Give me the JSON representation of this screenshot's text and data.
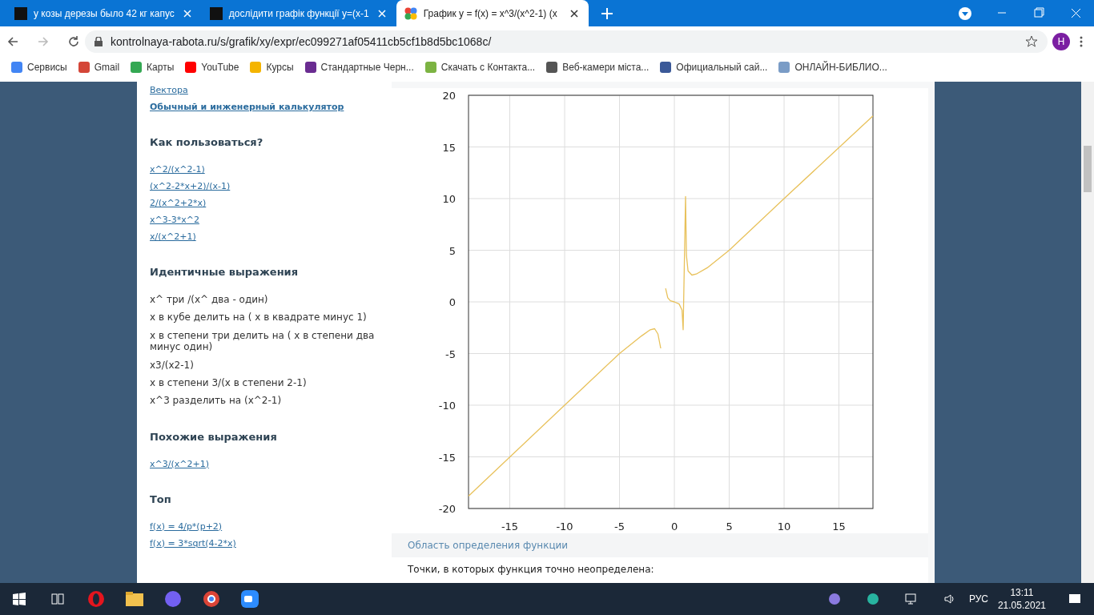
{
  "browser": {
    "tabs": [
      {
        "title": "у козы дерезы было 42 кг капус",
        "selected": false
      },
      {
        "title": "дослідити графік функції y=(x-1",
        "selected": false
      },
      {
        "title": "График y = f(x) = x^3/(x^2-1) (x",
        "selected": true
      }
    ],
    "url": "kontrolnaya-rabota.ru/s/grafik/xy/expr/ec099271af05411cb5cf1b8d5bc1068c/",
    "profile": "Н",
    "bookmarks": [
      {
        "label": "Сервисы",
        "color": "#4285f4"
      },
      {
        "label": "Gmail",
        "color": "#d44638"
      },
      {
        "label": "Карты",
        "color": "#34a853"
      },
      {
        "label": "YouTube",
        "color": "#ff0000"
      },
      {
        "label": "Курсы",
        "color": "#f4b400"
      },
      {
        "label": "Стандартные Черн...",
        "color": "#6a2c91"
      },
      {
        "label": "Скачать с Контакта...",
        "color": "#7cb342"
      },
      {
        "label": "Веб-камери міста...",
        "color": "#555555"
      },
      {
        "label": "Официальный сай...",
        "color": "#3b5998"
      },
      {
        "label": "ОНЛАЙН-БИБЛИО...",
        "color": "#7a9cc6"
      }
    ]
  },
  "sidebar": {
    "top_links": [
      {
        "text": "Вектора",
        "bold": false
      },
      {
        "text": "Обычный и инженерный калькулятор",
        "bold": true
      }
    ],
    "sections": [
      {
        "heading": "Как пользоваться?",
        "kind": "links",
        "items": [
          "x^2/(x^2-1)",
          "(x^2-2*x+2)/(x-1)",
          "2/(x^2+2*x)",
          "x^3-3*x^2",
          "x/(x^2+1)"
        ]
      },
      {
        "heading": "Идентичные выражения",
        "kind": "text",
        "items": [
          "x^ три /(x^ два - один)",
          "x в кубе делить на ( x в квадрате минус 1)",
          "x в степени три делить на ( x в степени два минус один)",
          "x3/(x2-1)",
          "x в степени 3/(x в степени 2-1)",
          "x^3 разделить на (x^2-1)"
        ]
      },
      {
        "heading": "Похожие выражения",
        "kind": "links",
        "items": [
          "x^3/(x^2+1)"
        ]
      },
      {
        "heading": "Топ",
        "kind": "links",
        "items": [
          "f(x) = 4/p*(p+2)",
          "f(x) = 3*sqrt(4-2*x)"
        ]
      }
    ]
  },
  "chart_data": {
    "type": "line",
    "grid": true,
    "xlim": [
      -18.76,
      18.1
    ],
    "ylim": [
      -20,
      20
    ],
    "xticks": [
      -15,
      -10,
      -5,
      0,
      5,
      10,
      15
    ],
    "yticks": [
      -20,
      -15,
      -10,
      -5,
      0,
      5,
      10,
      15,
      20
    ],
    "x": [
      -18.76,
      -10,
      -5,
      -3,
      -2.2,
      -1.8,
      -1.5,
      -1.24,
      -0.8,
      -0.6,
      -0.36,
      0,
      0.44,
      0.7,
      0.8,
      1.02,
      1.1,
      1.25,
      1.6,
      2,
      3,
      5,
      10,
      18.1
    ],
    "series": [
      {
        "color": "#e8c15a",
        "values": [
          -18.8,
          -10,
          -5,
          -3.3,
          -2.7,
          -2.6,
          -3.1,
          -4.5,
          null,
          null,
          null,
          null,
          null,
          null,
          null,
          null,
          null,
          null,
          null,
          null,
          null,
          null,
          null,
          null
        ]
      },
      {
        "color": "#e8c15a",
        "values": [
          null,
          null,
          null,
          null,
          null,
          null,
          null,
          null,
          1.3,
          0.4,
          0.1,
          0,
          -0.2,
          -0.8,
          -2.7,
          10.2,
          4.5,
          3.0,
          2.6,
          2.7,
          3.3,
          5,
          10,
          18
        ]
      }
    ]
  },
  "domain_section": {
    "title": "Область определения функции",
    "text": "Точки, в которых функция точно неопределена:"
  },
  "taskbar": {
    "language": "РУС",
    "time": "13:11",
    "date": "21.05.2021"
  }
}
